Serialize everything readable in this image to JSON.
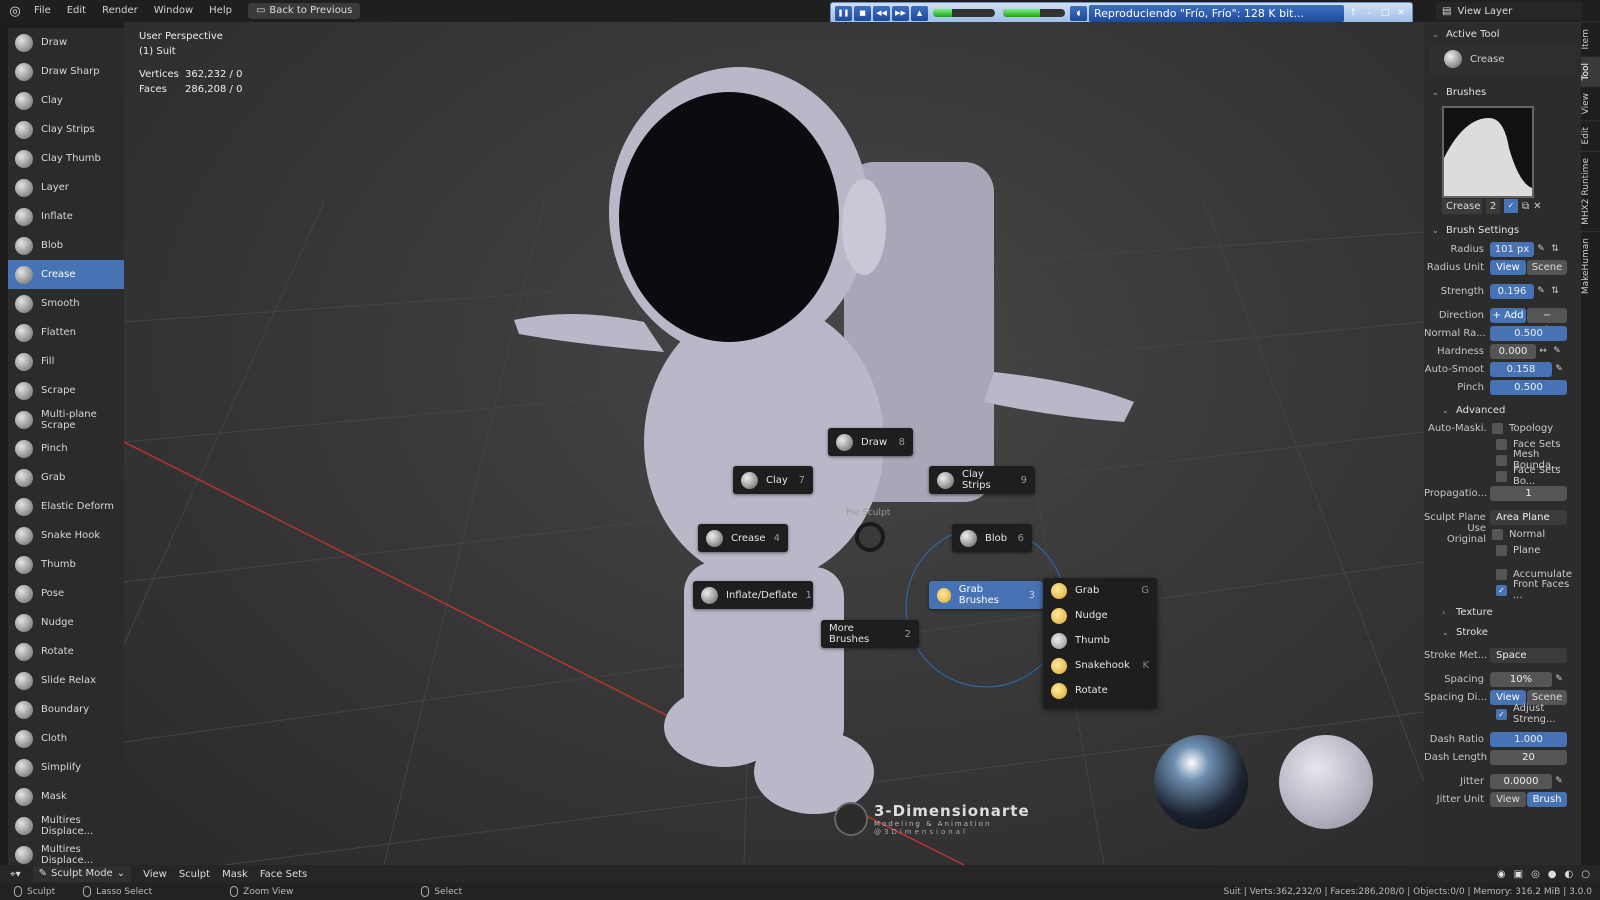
{
  "menu": {
    "items": [
      "File",
      "Edit",
      "Render",
      "Window",
      "Help"
    ],
    "back_label": "Back to Previous"
  },
  "media_player": {
    "title": "Reproduciendo \"Frío, Frío\": 128 K bit...",
    "volume_level": 0.6
  },
  "view_layer": {
    "label": "View Layer"
  },
  "tools": [
    "Draw",
    "Draw Sharp",
    "Clay",
    "Clay Strips",
    "Clay Thumb",
    "Layer",
    "Inflate",
    "Blob",
    "Crease",
    "Smooth",
    "Flatten",
    "Fill",
    "Scrape",
    "Multi-plane Scrape",
    "Pinch",
    "Grab",
    "Elastic Deform",
    "Snake Hook",
    "Thumb",
    "Pose",
    "Nudge",
    "Rotate",
    "Slide Relax",
    "Boundary",
    "Cloth",
    "Simplify",
    "Mask",
    "Multires Displace...",
    "Multires Displace..."
  ],
  "active_tool_index": 8,
  "viewport": {
    "perspective": "User Perspective",
    "object": "(1) Suit",
    "vertices_label": "Vertices",
    "vertices_value": "362,232 / 0",
    "faces_label": "Faces",
    "faces_value": "286,208 / 0"
  },
  "pie": {
    "title": "Pie Sculpt",
    "items": [
      {
        "label": "Draw",
        "key": "8"
      },
      {
        "label": "Clay",
        "key": "7"
      },
      {
        "label": "Clay Strips",
        "key": "9"
      },
      {
        "label": "Crease",
        "key": "4"
      },
      {
        "label": "Blob",
        "key": "6"
      },
      {
        "label": "Inflate/Deflate",
        "key": "1"
      },
      {
        "label": "Grab Brushes",
        "key": "3"
      },
      {
        "label": "More Brushes",
        "key": "2"
      }
    ],
    "submenu": [
      {
        "label": "Grab",
        "key": "G"
      },
      {
        "label": "Nudge",
        "key": ""
      },
      {
        "label": "Thumb",
        "key": ""
      },
      {
        "label": "Snakehook",
        "key": "K"
      },
      {
        "label": "Rotate",
        "key": ""
      }
    ]
  },
  "watermark": {
    "title": "3-Dimensionarte",
    "subtitle": "Modeling & Animation",
    "handle": "@3Dimensional"
  },
  "props": {
    "active_tool_header": "Active Tool",
    "active_tool_name": "Crease",
    "brushes_header": "Brushes",
    "brush_name": "Crease",
    "brush_users": "2",
    "brush_settings_header": "Brush Settings",
    "radius_label": "Radius",
    "radius_value": "101 px",
    "radius_unit_label": "Radius Unit",
    "radius_unit_view": "View",
    "radius_unit_scene": "Scene",
    "strength_label": "Strength",
    "strength_value": "0.196",
    "direction_label": "Direction",
    "direction_add": "+ Add",
    "direction_sub": "− Sub...",
    "normal_label": "Normal Ra...",
    "normal_value": "0.500",
    "hardness_label": "Hardness",
    "hardness_value": "0.000",
    "autosmooth_label": "Auto-Smoot",
    "autosmooth_value": "0.158",
    "pinch_label": "Pinch",
    "pinch_value": "0.500",
    "advanced_header": "Advanced",
    "automask_label": "Auto-Maski...",
    "automask_topology": "Topology",
    "automask_facesets": "Face Sets",
    "automask_mesh": "Mesh Bounda...",
    "automask_facesets_bo": "Face Sets Bo...",
    "propagation_label": "Propagatio...",
    "propagation_value": "1",
    "sculpt_plane_label": "Sculpt Plane",
    "sculpt_plane_value": "Area Plane",
    "use_original_label": "Use Original",
    "use_original_normal": "Normal",
    "use_original_plane": "Plane",
    "accumulate": "Accumulate",
    "front_faces": "Front Faces ...",
    "texture_header": "Texture",
    "stroke_header": "Stroke",
    "stroke_method_label": "Stroke Met...",
    "stroke_method_value": "Space",
    "spacing_label": "Spacing",
    "spacing_value": "10%",
    "spacing_dist_label": "Spacing Di...",
    "spacing_dist_view": "View",
    "spacing_dist_scene": "Scene",
    "adjust_strength": "Adjust Streng...",
    "dash_ratio_label": "Dash Ratio",
    "dash_ratio_value": "1.000",
    "dash_length_label": "Dash Length",
    "dash_length_value": "20",
    "jitter_label": "Jitter",
    "jitter_value": "0.0000",
    "jitter_unit_label": "Jitter Unit",
    "jitter_unit_view": "View",
    "jitter_unit_brush": "Brush"
  },
  "vertical_tabs": [
    "Item",
    "Tool",
    "View",
    "Edit",
    "MHX2 Runtime",
    "MakeHuman"
  ],
  "header_bottom": {
    "mode": "Sculpt Mode",
    "items": [
      "View",
      "Sculpt",
      "Mask",
      "Face Sets"
    ]
  },
  "statusbar": {
    "sculpt": "Sculpt",
    "lasso": "Lasso Select",
    "zoom": "Zoom View",
    "select": "Select",
    "right": "Suit | Verts:362,232/0 | Faces:286,208/0 | Objects:0/0 | Memory: 316.2 MiB | 3.0.0"
  },
  "colors": {
    "accent": "#4772b3",
    "header_bg": "#1f1f1f",
    "panel_bg": "#2c2c2c",
    "media_bg": "#9cbde5"
  }
}
